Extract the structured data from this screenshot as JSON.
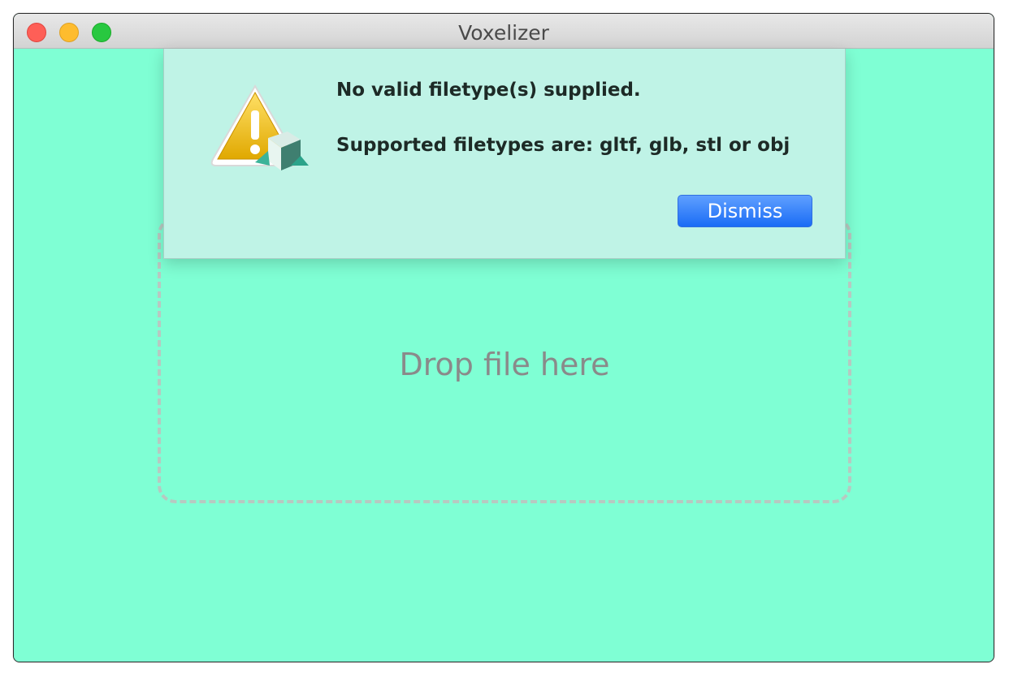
{
  "window": {
    "title": "Voxelizer",
    "controls": [
      "close",
      "minimize",
      "zoom"
    ]
  },
  "dropzone": {
    "label": "Drop file here"
  },
  "dialog": {
    "icon": "warning-icon",
    "message_line1": "No valid filetype(s) supplied.",
    "message_line2": "Supported filetypes are: gltf, glb, stl or obj",
    "dismiss_label": "Dismiss"
  },
  "colors": {
    "background": "#7fffd4",
    "dialog_bg": "#bff3e6",
    "accent_button": "#1a6cf5"
  }
}
